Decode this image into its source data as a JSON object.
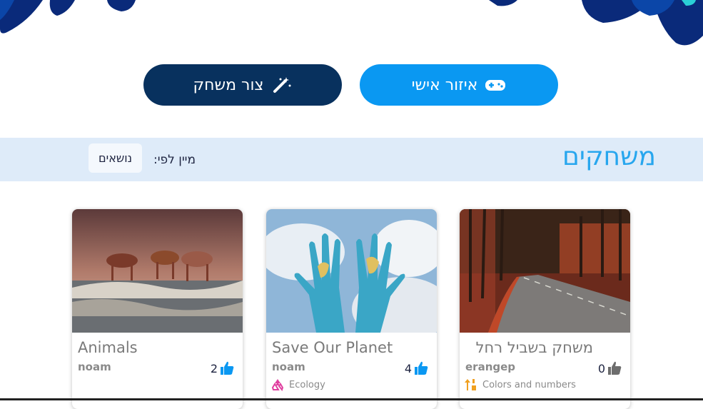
{
  "nav": {
    "create_game_label": "צור משחק",
    "personal_area_label": "איזור אישי"
  },
  "games_section": {
    "title": "משחקים",
    "sort_label": "מיין לפי:",
    "sort_value": "נושאים"
  },
  "colors": {
    "dark_blue": "#08315e",
    "accent_blue": "#0a98f2",
    "bar_bg": "#deebf9",
    "title_blue": "#27a6ee"
  },
  "cards": [
    {
      "title": "Animals",
      "author": "noam",
      "likes": "2",
      "topic": "",
      "image": "horses"
    },
    {
      "title": "Save Our Planet",
      "author": "noam",
      "likes": "4",
      "topic": "Ecology",
      "topic_icon": "recycle-icon",
      "image": "painted-hands"
    },
    {
      "title": "משחק בשביל רחל",
      "author": "erangep",
      "likes": "0",
      "topic": "Colors and numbers",
      "topic_icon": "sort-icon",
      "image": "autumn-road"
    }
  ]
}
